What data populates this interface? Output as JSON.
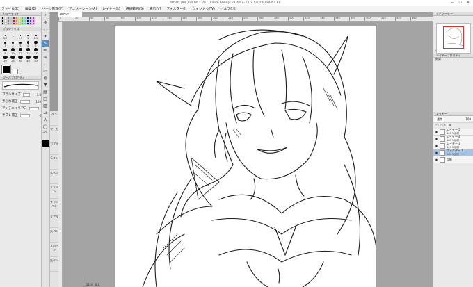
{
  "window": {
    "title": "PM59* (A4 210.00 x 297.00mm 600dpi 21.4%) - CLIP STUDIO PAINT EX",
    "min_symbol": "—",
    "max_symbol": "☐",
    "close_symbol": "✕"
  },
  "menu": {
    "items": [
      "ファイル(E)",
      "編集(E)",
      "ページ管理(P)",
      "アニメーション(A)",
      "レイヤー(L)",
      "選択範囲(S)",
      "表示(V)",
      "フィルター(I)",
      "ウィンドウ(W)",
      "ヘルプ(H)"
    ]
  },
  "left_panel": {
    "color_set_title": "カラーセット",
    "brush_size_title": "ブラシサイズ",
    "brush_sizes": [
      "0.7",
      "1",
      "1.5",
      "2",
      "2.5",
      "3",
      "4",
      "5",
      "6",
      "7",
      "8",
      "10",
      "12",
      "15",
      "17",
      "20",
      "25",
      "30",
      "40",
      "50"
    ],
    "tool_property_title": "ツールプロパティ",
    "props": [
      {
        "label": "ブラシサイズ",
        "value": "3.0"
      },
      {
        "label": "手ぶれ補正",
        "value": "100"
      },
      {
        "label": "アンチエイリアス",
        "value": ""
      },
      {
        "label": "手ブレ補正",
        "value": "6"
      }
    ]
  },
  "subtools": [
    "ペン",
    "マーカー",
    "カブラ",
    "Gペン",
    "丸ペン",
    "ミリペン",
    "サインペン",
    "リアル",
    "丸ペン",
    "太めペン",
    "先ペン"
  ],
  "canvas": {
    "doc_tab": "PM59*",
    "ruler_marks": [
      "0",
      "20",
      "40",
      "60",
      "80",
      "100",
      "120",
      "140",
      "160",
      "180",
      "200",
      "220",
      "240",
      "260",
      "280",
      "300",
      "320",
      "340",
      "360",
      "380",
      "400",
      "420",
      "440",
      "460"
    ],
    "zoom": "21.4",
    "angle": "0.0"
  },
  "right_panel": {
    "navigator_title": "ナビゲーター",
    "layer_prop_title": "レイヤープロパティ",
    "effect_label": "効果",
    "layer_title": "レイヤー",
    "blend_mode": "通常",
    "opacity": "100",
    "layers": [
      {
        "name": "レイヤー 5",
        "pct": "100 %通常",
        "selected": false
      },
      {
        "name": "レイヤー 4",
        "pct": "100 %通常",
        "selected": false
      },
      {
        "name": "レイヤー 3",
        "pct": "100 %通常",
        "selected": false
      },
      {
        "name": "フォルダー 1",
        "pct": "100 %通常",
        "selected": true
      },
      {
        "name": "用紙",
        "pct": "",
        "selected": false
      }
    ]
  },
  "colors": {
    "accent": "#5a8cc4",
    "selected_layer": "#a8c4e4",
    "navigator_frame": "#e03030"
  }
}
